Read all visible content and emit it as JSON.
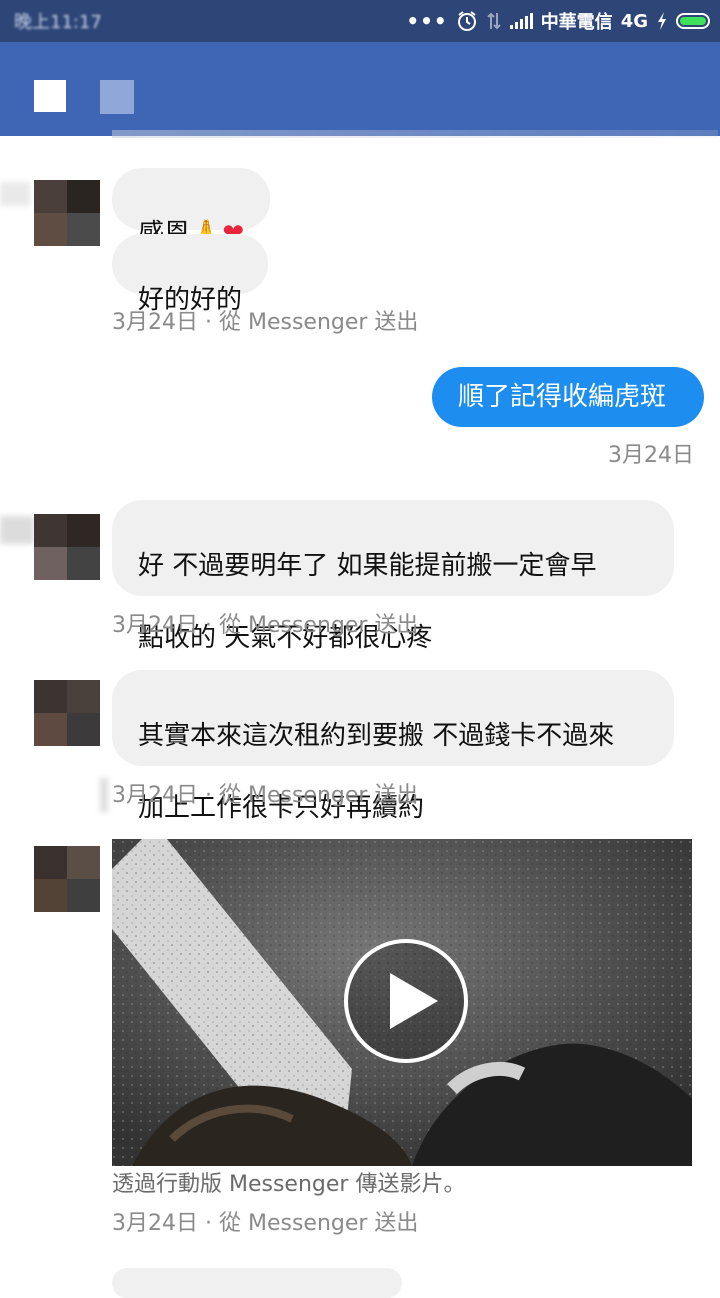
{
  "status_bar": {
    "time": "晚上11:17",
    "carrier": "中華電信",
    "network": "4G",
    "battery_level": 1.0,
    "icons": [
      "more-dots-icon",
      "alarm-icon",
      "data-arrows-icon",
      "signal-icon",
      "charging-icon",
      "battery-icon"
    ]
  },
  "header": {
    "icons": [
      "back-button-placeholder",
      "contact-name-placeholder"
    ]
  },
  "messages": [
    {
      "direction": "incoming",
      "bubbles": [
        {
          "text": "感恩",
          "emoji": [
            "folded-hands",
            "red-heart"
          ]
        },
        {
          "text": "好的好的"
        }
      ],
      "meta": "3月24日 · 從 Messenger 送出"
    },
    {
      "direction": "outgoing",
      "text": "順了記得收編虎斑",
      "meta": "3月24日"
    },
    {
      "direction": "incoming",
      "text_lines": [
        "好 不過要明年了 如果能提前搬一定會早",
        "點收的 天氣不好都很心疼"
      ],
      "meta": "3月24日 · 從 Messenger 送出"
    },
    {
      "direction": "incoming",
      "text_lines": [
        "其實本來這次租約到要搬 不過錢卡不過來",
        "加上工作很卡只好再續約"
      ],
      "meta": "3月24日 · 從 Messenger 送出"
    },
    {
      "direction": "incoming",
      "type": "video",
      "caption": "透過行動版 Messenger 傳送影片。",
      "meta": "3月24日 · 從 Messenger 送出"
    }
  ],
  "colors": {
    "status_bar": "#2d4577",
    "header": "#3f66b5",
    "outgoing_bubble": "#1d8ef0",
    "incoming_bubble": "#f0f0f0",
    "meta_text": "#8a8a8a"
  }
}
